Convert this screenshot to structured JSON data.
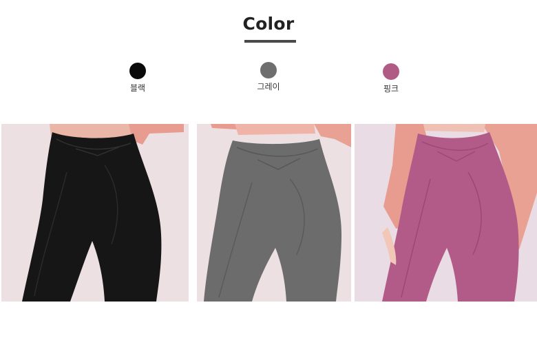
{
  "heading": "Color",
  "colors": [
    {
      "label": "블랙",
      "swatch": "#0a0a0a",
      "legging": "#161616"
    },
    {
      "label": "그레이",
      "swatch": "#6e6e6e",
      "legging": "#6c6c6c"
    },
    {
      "label": "핑크",
      "swatch": "#b05a86",
      "legging": "#b25b88"
    }
  ],
  "accent_colors": {
    "top_pink": "#e8a193",
    "background": "#eedfe2"
  }
}
